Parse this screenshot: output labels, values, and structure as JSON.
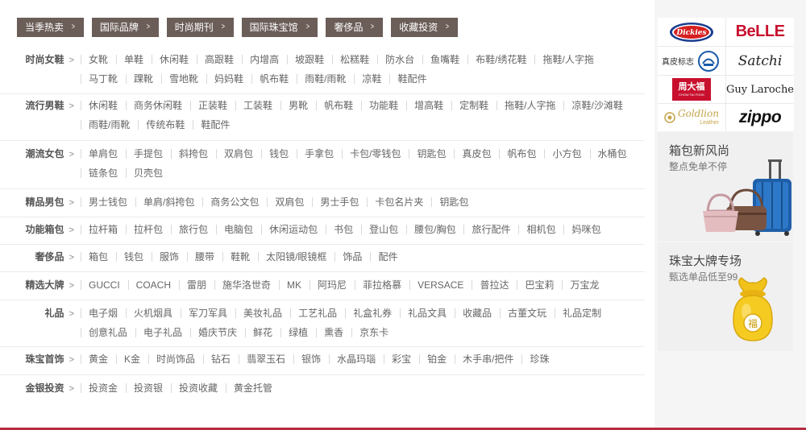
{
  "tabs": [
    "当季热卖",
    "国际品牌",
    "时尚期刊",
    "国际珠宝馆",
    "奢侈品",
    "收藏投资"
  ],
  "categories": [
    {
      "name": "时尚女鞋",
      "items": [
        "女靴",
        "单鞋",
        "休闲鞋",
        "高跟鞋",
        "内增高",
        "坡跟鞋",
        "松糕鞋",
        "防水台",
        "鱼嘴鞋",
        "布鞋/绣花鞋",
        "拖鞋/人字拖",
        "马丁靴",
        "踝靴",
        "雪地靴",
        "妈妈鞋",
        "帆布鞋",
        "雨鞋/雨靴",
        "凉鞋",
        "鞋配件"
      ]
    },
    {
      "name": "流行男鞋",
      "items": [
        "休闲鞋",
        "商务休闲鞋",
        "正装鞋",
        "工装鞋",
        "男靴",
        "帆布鞋",
        "功能鞋",
        "增高鞋",
        "定制鞋",
        "拖鞋/人字拖",
        "凉鞋/沙滩鞋",
        "雨鞋/雨靴",
        "传统布鞋",
        "鞋配件"
      ]
    },
    {
      "name": "潮流女包",
      "items": [
        "单肩包",
        "手提包",
        "斜挎包",
        "双肩包",
        "钱包",
        "手拿包",
        "卡包/零钱包",
        "钥匙包",
        "真皮包",
        "帆布包",
        "小方包",
        "水桶包",
        "链条包",
        "贝壳包"
      ]
    },
    {
      "name": "精品男包",
      "items": [
        "男士钱包",
        "单肩/斜挎包",
        "商务公文包",
        "双肩包",
        "男士手包",
        "卡包名片夹",
        "钥匙包"
      ]
    },
    {
      "name": "功能箱包",
      "items": [
        "拉杆箱",
        "拉杆包",
        "旅行包",
        "电脑包",
        "休闲运动包",
        "书包",
        "登山包",
        "腰包/胸包",
        "旅行配件",
        "相机包",
        "妈咪包"
      ]
    },
    {
      "name": "奢侈品",
      "items": [
        "箱包",
        "钱包",
        "服饰",
        "腰带",
        "鞋靴",
        "太阳镜/眼镜框",
        "饰品",
        "配件"
      ]
    },
    {
      "name": "精选大牌",
      "items": [
        "GUCCI",
        "COACH",
        "雷朋",
        "施华洛世奇",
        "MK",
        "阿玛尼",
        "菲拉格慕",
        "VERSACE",
        "普拉达",
        "巴宝莉",
        "万宝龙"
      ]
    },
    {
      "name": "礼品",
      "items": [
        "电子烟",
        "火机烟具",
        "军刀军具",
        "美妆礼品",
        "工艺礼品",
        "礼盒礼券",
        "礼品文具",
        "收藏品",
        "古董文玩",
        "礼品定制",
        "创意礼品",
        "电子礼品",
        "婚庆节庆",
        "鲜花",
        "绿植",
        "熏香",
        "京东卡"
      ]
    },
    {
      "name": "珠宝首饰",
      "items": [
        "黄金",
        "K金",
        "时尚饰品",
        "钻石",
        "翡翠玉石",
        "银饰",
        "水晶玛瑙",
        "彩宝",
        "铂金",
        "木手串/把件",
        "珍珠"
      ]
    },
    {
      "name": "金银投资",
      "items": [
        "投资金",
        "投资银",
        "投资收藏",
        "黄金托管"
      ]
    }
  ],
  "brands": {
    "dickies": "Dickies",
    "belle": "BeLLE",
    "zhenpi": "真皮标志",
    "satchi": "Satchi",
    "chowtaifook_cn": "周大福",
    "chowtaifook_en": "CHOW TAI FOOK",
    "guylaroche": "Guy Laroche",
    "goldlion": "Goldlion",
    "goldlion_sub": "Leather",
    "zippo": "ZIPPO"
  },
  "promos": [
    {
      "title": "箱包新风尚",
      "subtitle": "整点免单不停"
    },
    {
      "title": "珠宝大牌专场",
      "subtitle": "甄选单品低至99"
    }
  ],
  "colors": {
    "tab_bg": "#6b5d58",
    "accent": "#b72b3f"
  }
}
